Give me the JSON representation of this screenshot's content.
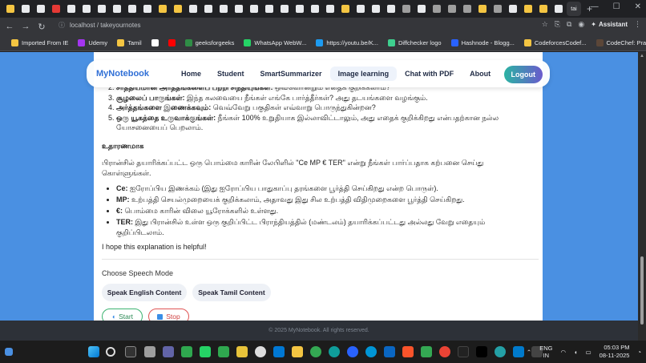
{
  "browser": {
    "tabs": [
      "",
      "",
      "",
      "",
      "",
      "",
      "",
      "",
      "",
      "",
      "",
      "",
      "",
      "",
      "",
      "",
      "",
      "",
      "",
      "",
      "",
      "",
      "",
      "",
      "",
      "",
      "",
      "",
      "",
      "",
      "",
      "",
      "",
      "",
      "",
      "",
      "",
      ""
    ],
    "active_tab_title": "tai",
    "new_tab": "+",
    "url_host": "localhost",
    "url_path": "/ takeyournotes",
    "assistant_label": "Assistant",
    "bookmarks": [
      {
        "label": "Imported From IE",
        "color": "#f4c542"
      },
      {
        "label": "Udemy",
        "color": "#a435f0"
      },
      {
        "label": "Tamil",
        "color": "#f4c542"
      },
      {
        "label": "",
        "color": "#ffffff"
      },
      {
        "label": "",
        "color": "#ff0000"
      },
      {
        "label": "geeksforgeeks",
        "color": "#2f8d46"
      },
      {
        "label": "WhatsApp WebW...",
        "color": "#25d366"
      },
      {
        "label": "https://youtu.be/K...",
        "color": "#1d9bf0"
      },
      {
        "label": "Diffchecker logo",
        "color": "#3ecf8e"
      },
      {
        "label": "Hashnode - Blogg...",
        "color": "#2962ff"
      },
      {
        "label": "CodeforcesCodef...",
        "color": "#f4c542"
      },
      {
        "label": "CodeChef: Practic...",
        "color": "#5b4638"
      }
    ]
  },
  "nav": {
    "logo": "MyNotebook",
    "links": [
      "Home",
      "Student",
      "SmartSummarizer",
      "Image learning",
      "Chat with PDF",
      "About"
    ],
    "active": "Image learning",
    "logout": "Logout"
  },
  "content": {
    "list_items": [
      {
        "bold": "சாத்தியமான அர்த்தங்களைப் பற்றி சிந்தியுங்கள்:",
        "text": " ஒவ்வொன்றும் எதைக் குறிக்கலாம்?"
      },
      {
        "bold": "சூழலைப் பாருங்கள்:",
        "text": " இந்த கலவையை நீங்கள் எங்கே பார்த்தீர்கள்? அது தடயங்களை வழங்கும்."
      },
      {
        "bold": "அர்த்தங்களை இணைக்கவும்:",
        "text": " வெவ்வேறு பகுதிகள் எவ்வாறு பொருந்துகின்றன?"
      },
      {
        "bold": "ஒரு யூகத்தை உருவாக்குங்கள்:",
        "text": " நீங்கள் 100% உறுதியாக இல்லாவிட்டாலும், அது எதைக் குறிக்கிறது என்பதற்கான நல்ல யோசனையைப் பெறலாம்."
      }
    ],
    "example_heading": "உதாரணமாக",
    "example_para": "பிரான்சில் தயாரிக்கப்பட்ட ஒரு பொம்மை காரின் லேபிளில் \"Ce MP € TER\" என்று நீங்கள் பார்ப்பதாக கற்பனை செய்து கொள்ளுங்கள்.",
    "bullets": [
      {
        "bold": "Ce:",
        "text": " ஐரோப்பிய இணக்கம் (இது ஐரோப்பிய பாதுகாப்பு தரங்களை பூர்த்தி செய்கிறது என்ற பொருள்)."
      },
      {
        "bold": "MP:",
        "text": " உற்பத்தி செயல்முறையைக் குறிக்கலாம், அதாவது இது சில உற்பத்தி விதிமுறைகளை பூர்த்தி செய்கிறது."
      },
      {
        "bold": "€:",
        "text": " பொம்மை காரின் விலை யூரோக்களில் உள்ளது."
      },
      {
        "bold": "TER:",
        "text": " இது பிரான்சில் உள்ள ஒரு குறிப்பிட்ட பிராந்தியத்தில் (மண்டலம்) தயாரிக்கப்பட்டது அல்லது வேறு எதையும் குறிப்பிடலாம்."
      }
    ],
    "closing": "I hope this explanation is helpful!"
  },
  "speech": {
    "label": "Choose Speech Mode",
    "english_button": "Speak English Content",
    "tamil_button": "Speak Tamil Content",
    "start": "Start",
    "stop": "Stop"
  },
  "footer": "© 2025 MyNotebook. All rights reserved.",
  "taskbar": {
    "lang_top": "ENG",
    "lang_bottom": "IN",
    "time": "05:03 PM",
    "date": "08-11-2025"
  }
}
